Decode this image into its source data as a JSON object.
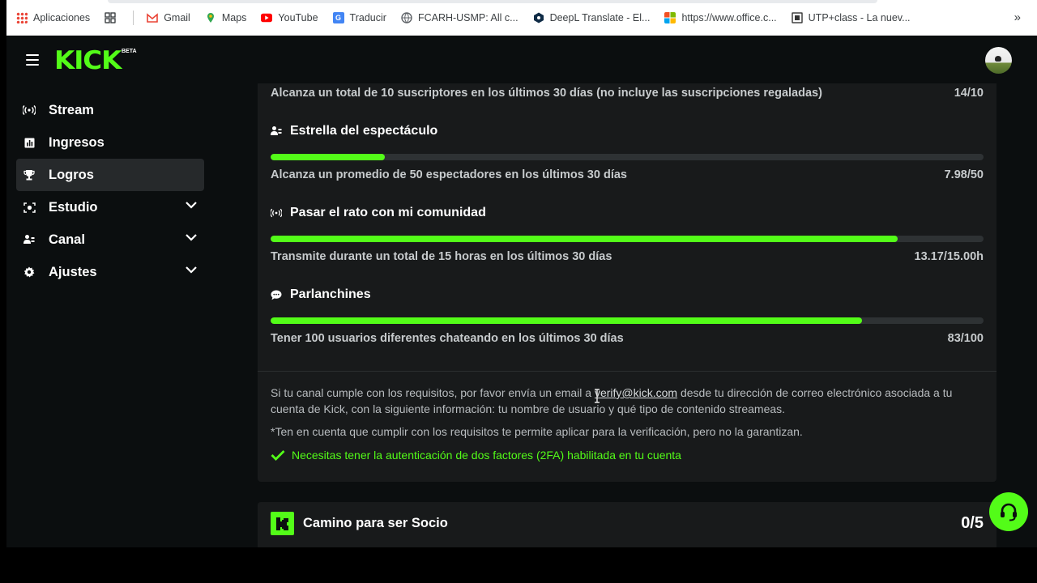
{
  "bookmarks": [
    {
      "label": "Aplicaciones",
      "icon": "apps-grid-icon"
    },
    {
      "label": "",
      "icon": "squares-icon"
    },
    {
      "label": "Gmail",
      "icon": "gmail-icon"
    },
    {
      "label": "Maps",
      "icon": "maps-icon"
    },
    {
      "label": "YouTube",
      "icon": "youtube-icon"
    },
    {
      "label": "Traducir",
      "icon": "translate-icon"
    },
    {
      "label": "FCARH-USMP: All c...",
      "icon": "globe-icon"
    },
    {
      "label": "DeepL Translate - El...",
      "icon": "deepl-icon"
    },
    {
      "label": "https://www.office.c...",
      "icon": "office-icon"
    },
    {
      "label": "UTP+class - La nuev...",
      "icon": "utp-icon"
    }
  ],
  "bookmarks_more": "»",
  "header": {
    "logo": "KICK",
    "beta": "BETA"
  },
  "sidebar": {
    "items": [
      {
        "label": "Stream",
        "icon": "broadcast-icon",
        "active": false,
        "expandable": false
      },
      {
        "label": "Ingresos",
        "icon": "chart-icon",
        "active": false,
        "expandable": false
      },
      {
        "label": "Logros",
        "icon": "trophy-icon",
        "active": true,
        "expandable": false
      },
      {
        "label": "Estudio",
        "icon": "camera-icon",
        "active": false,
        "expandable": true
      },
      {
        "label": "Canal",
        "icon": "users-icon",
        "active": false,
        "expandable": true
      },
      {
        "label": "Ajustes",
        "icon": "gear-icon",
        "active": false,
        "expandable": true
      }
    ]
  },
  "achievements": {
    "top_partial": {
      "description": "Alcanza un total de 10 suscriptores en los últimos 30 días (no incluye las suscripciones regaladas)",
      "value": "14/10"
    },
    "items": [
      {
        "title": "Estrella del espectáculo",
        "icon": "users-icon",
        "progress": 0.16,
        "description": "Alcanza un promedio de 50 espectadores en los últimos 30 días",
        "value": "7.98/50"
      },
      {
        "title": "Pasar el rato con mi comunidad",
        "icon": "broadcast-icon",
        "progress": 0.88,
        "description": "Transmite durante un total de 15 horas en los últimos 30 días",
        "value": "13.17/15.00h"
      },
      {
        "title": "Parlanchines",
        "icon": "chat-icon",
        "progress": 0.83,
        "description": "Tener 100 usuarios diferentes chateando en los últimos 30 días",
        "value": "83/100"
      }
    ]
  },
  "verify": {
    "text_before": "Si tu canal cumple con los requisitos, por favor envía un email a ",
    "email": "verify@kick.com",
    "text_after": " desde tu dirección de correo electrónico asociada a tu cuenta de Kick, con la siguiente información: tu nombre de usuario y qué tipo de contenido streameas.",
    "note": "*Ten en cuenta que cumplir con los requisitos te permite aplicar para la verificación, pero no la garantizan.",
    "check": "Necesitas tener la autenticación de dos factores (2FA) habilitada en tu cuenta"
  },
  "partner": {
    "title": "Camino para ser Socio",
    "count": "0/5"
  },
  "colors": {
    "accent": "#53fc18",
    "background": "#0b0e0f",
    "card": "#181a1b",
    "track": "#2e3234"
  }
}
